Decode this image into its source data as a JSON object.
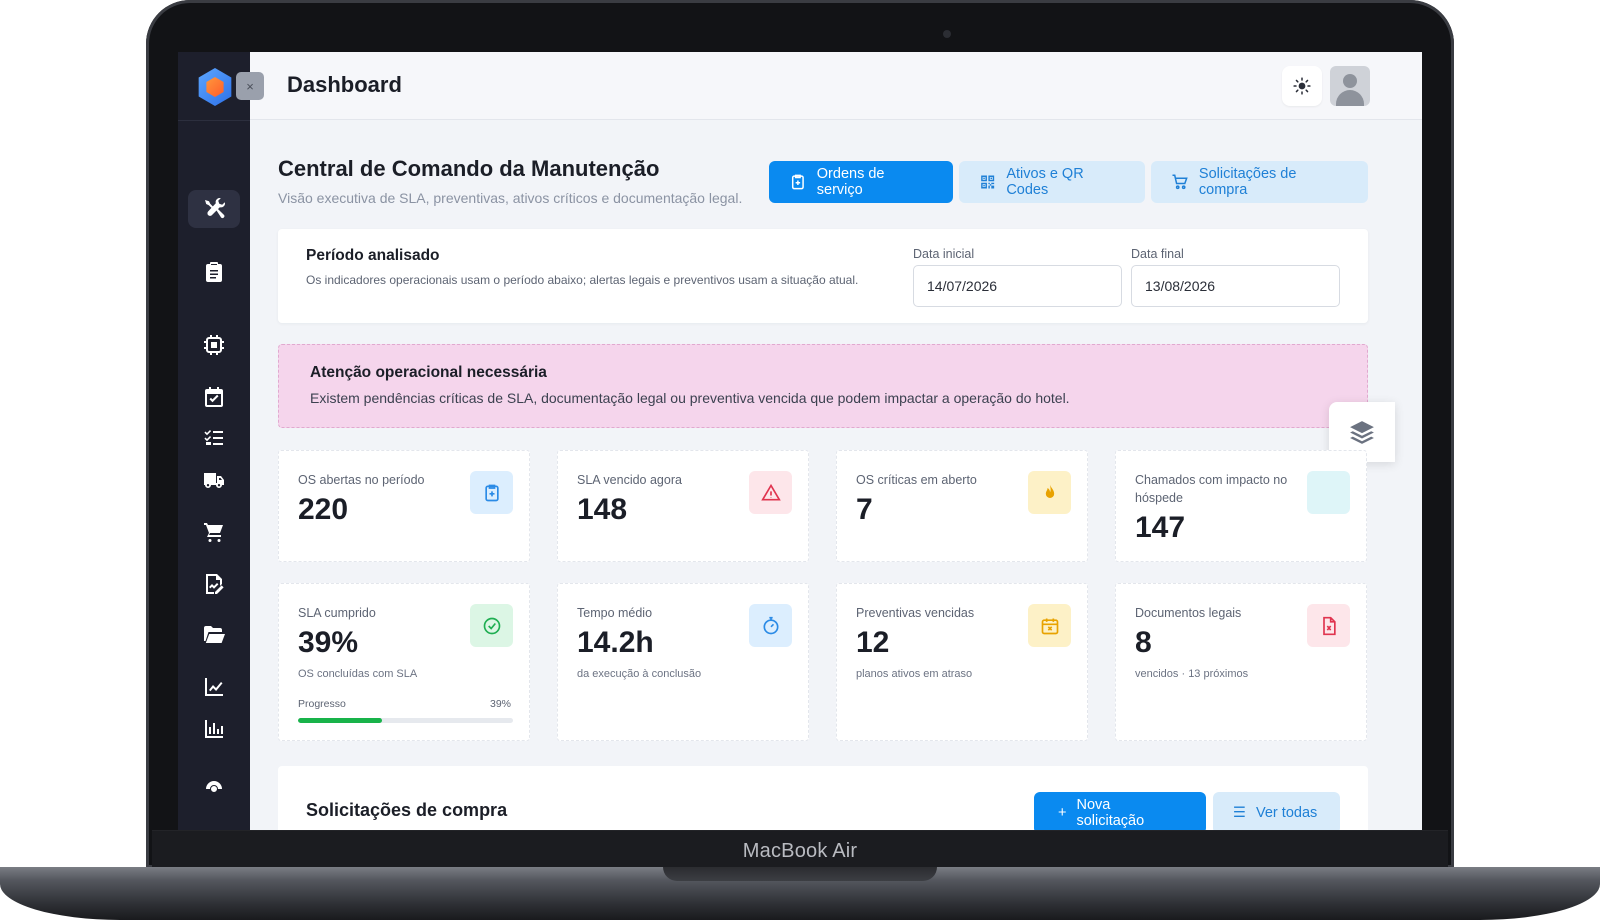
{
  "device": {
    "label": "MacBook Air"
  },
  "header": {
    "title": "Dashboard"
  },
  "hero": {
    "title": "Central de Comando da Manutenção",
    "subtitle": "Visão executiva de SLA, preventivas, ativos críticos e documentação legal."
  },
  "actions": {
    "orders": "Ordens de serviço",
    "assets": "Ativos e QR Codes",
    "purchases": "Solicitações de compra"
  },
  "period": {
    "title": "Período analisado",
    "description": "Os indicadores operacionais usam o período abaixo; alertas legais e preventivos usam a situação atual.",
    "start_label": "Data inicial",
    "start_value": "14/07/2026",
    "end_label": "Data final",
    "end_value": "13/08/2026"
  },
  "alert": {
    "title": "Atenção operacional necessária",
    "text": "Existem pendências críticas de SLA, documentação legal ou preventiva vencida que podem impactar a operação do hotel."
  },
  "kpis": [
    {
      "label": "OS abertas no período",
      "value": "220",
      "icon": "clipboard-plus-icon",
      "color": "#2b8be6",
      "bg": "#dceefe"
    },
    {
      "label": "SLA vencido agora",
      "value": "148",
      "icon": "warning-triangle-icon",
      "color": "#e0344f",
      "bg": "#fde6ea"
    },
    {
      "label": "OS críticas em aberto",
      "value": "7",
      "icon": "flame-icon",
      "color": "#e8a200",
      "bg": "#fdf1c7"
    },
    {
      "label": "Chamados com impacto no hóspede",
      "value": "147",
      "icon": "guest-icon",
      "color": "#39b7c9",
      "bg": "#def5f8"
    },
    {
      "label": "SLA cumprido",
      "value": "39%",
      "caption": "OS concluídas com SLA",
      "icon": "check-circle-icon",
      "color": "#1fae52",
      "bg": "#dcf6e5",
      "progress_label": "Progresso",
      "progress_text": "39%",
      "progress": 0.39
    },
    {
      "label": "Tempo médio",
      "value": "14.2h",
      "caption": "da execução à conclusão",
      "icon": "stopwatch-icon",
      "color": "#2b8be6",
      "bg": "#dceefe"
    },
    {
      "label": "Preventivas vencidas",
      "value": "12",
      "caption": "planos ativos em atraso",
      "icon": "calendar-x-icon",
      "color": "#e8a200",
      "bg": "#fdf1c7"
    },
    {
      "label": "Documentos legais",
      "value": "8",
      "caption": "vencidos · 13 próximos",
      "icon": "file-x-icon",
      "color": "#e0344f",
      "bg": "#fde6ea"
    }
  ],
  "purchases": {
    "title": "Solicitações de compra",
    "new_button": "Nova solicitação",
    "all_button": "Ver todas"
  },
  "colors": {
    "primary": "#0a8af0",
    "sidebar": "#1d1f2c",
    "alert_bg": "#f5d5ec"
  }
}
